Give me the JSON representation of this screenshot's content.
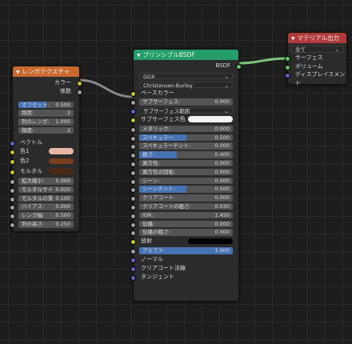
{
  "brick_node": {
    "title": "レンガテクスチャ",
    "outputs": [
      "カラー",
      "係数"
    ],
    "params_top": [
      {
        "label": "オフセット:",
        "value": "0.500",
        "fill": 0.5
      },
      {
        "label": "頻度:",
        "value": "2"
      },
      {
        "label": "列のレンガ:",
        "value": "1.000"
      },
      {
        "label": "頻度:",
        "value": "2"
      }
    ],
    "vector_label": "ベクトル",
    "colors": [
      {
        "label": "色1",
        "color": "#e8b6a4"
      },
      {
        "label": "色2",
        "color": "#7a3f1c"
      },
      {
        "label": "モルタル",
        "color": "#4a2a14"
      }
    ],
    "params_bottom": [
      {
        "label": "拡大縮小:",
        "value": "5.000"
      },
      {
        "label": "モルタルサイズ:",
        "value": "0.020"
      },
      {
        "label": "モルタルの滑らか:",
        "value": "0.100"
      },
      {
        "label": "バイアス:",
        "value": "0.000"
      },
      {
        "label": "レンガ幅:",
        "value": "0.500"
      },
      {
        "label": "列の高さ:",
        "value": "0.250"
      }
    ],
    "header_color": "#c9682e"
  },
  "bsdf_node": {
    "title": "プリンシプルBSDF",
    "output": "BSDF",
    "distribution": "GGX",
    "subsurface_method": "Christensen-Burley",
    "base_color_label": "ベースカラー",
    "sub_surface_label": "サブサーフェス:",
    "sub_surface_value": "0.000",
    "sub_range_label": "サブサーフェス範囲",
    "sub_color_label": "サブサーフェス色",
    "params": [
      {
        "label": "メタリック:",
        "value": "0.000",
        "fill": 0
      },
      {
        "label": "スペキュラー:",
        "value": "0.500",
        "fill": 0.5
      },
      {
        "label": "スペキュラーチント:",
        "value": "0.000",
        "fill": 0
      },
      {
        "label": "粗さ:",
        "value": "0.400",
        "fill": 0.4
      },
      {
        "label": "異方性:",
        "value": "0.000",
        "fill": 0
      },
      {
        "label": "異方性の回転:",
        "value": "0.000",
        "fill": 0
      },
      {
        "label": "シーン:",
        "value": "0.000",
        "fill": 0
      },
      {
        "label": "シーンチント:",
        "value": "0.500",
        "fill": 0.5
      },
      {
        "label": "クリアコート:",
        "value": "0.000",
        "fill": 0
      },
      {
        "label": "クリアコートの粗さ:",
        "value": "0.030",
        "fill": 0
      },
      {
        "label": "IOR:",
        "value": "1.450",
        "fill": 0
      },
      {
        "label": "伝播:",
        "value": "0.000",
        "fill": 0
      },
      {
        "label": "伝播の粗さ:",
        "value": "0.000",
        "fill": 0
      }
    ],
    "emission_label": "放射",
    "alpha_label": "アルファ:",
    "alpha_value": "1.000",
    "alpha_fill": 1.0,
    "vector_inputs": [
      "ノーマル",
      "クリアコート法線",
      "タンジェント"
    ],
    "header_color": "#249d6a"
  },
  "output_node": {
    "title": "マテリアル出力",
    "target": "全て",
    "inputs": [
      "サーフェス",
      "ボリューム",
      "ディスプレイスメント"
    ],
    "header_color": "#b13a3a"
  }
}
